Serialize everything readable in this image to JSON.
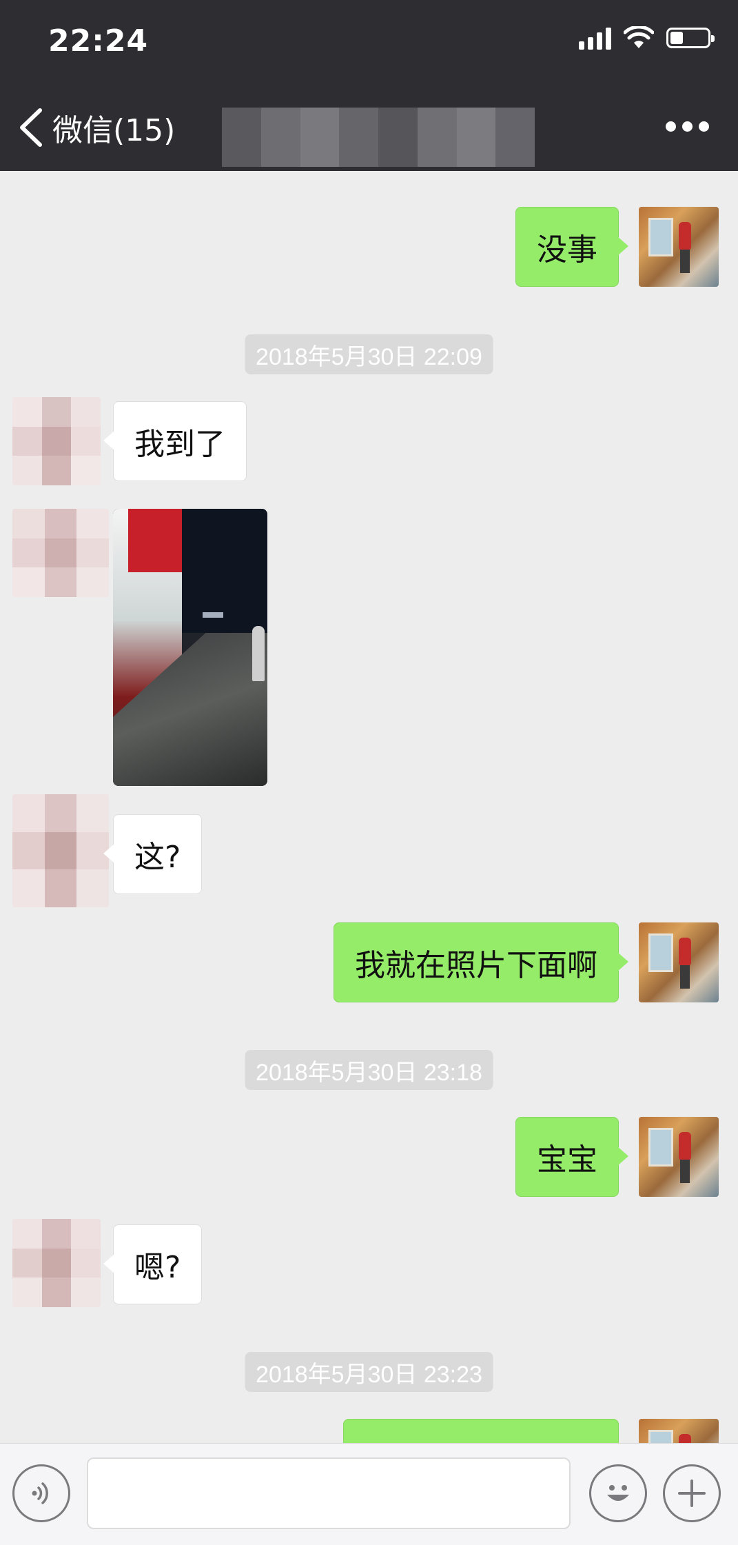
{
  "status_bar": {
    "time": "22:24"
  },
  "nav": {
    "back_label": "微信(15)",
    "title": ""
  },
  "messages": [
    {
      "text": "没事"
    },
    {
      "text": "2018年5月30日 22:09"
    },
    {
      "text": "我到了"
    },
    {
      "text": "这?"
    },
    {
      "text": "我就在照片下面啊"
    },
    {
      "text": "2018年5月30日 23:18"
    },
    {
      "text": "宝宝"
    },
    {
      "text": "嗯?"
    },
    {
      "text": "2018年5月30日 23:23"
    }
  ],
  "colors": {
    "header_bg": "#2e2e32",
    "chat_bg": "#ededed",
    "bubble_me": "#95ec69",
    "bubble_other": "#ffffff",
    "timestamp_bg": "#dadada"
  }
}
